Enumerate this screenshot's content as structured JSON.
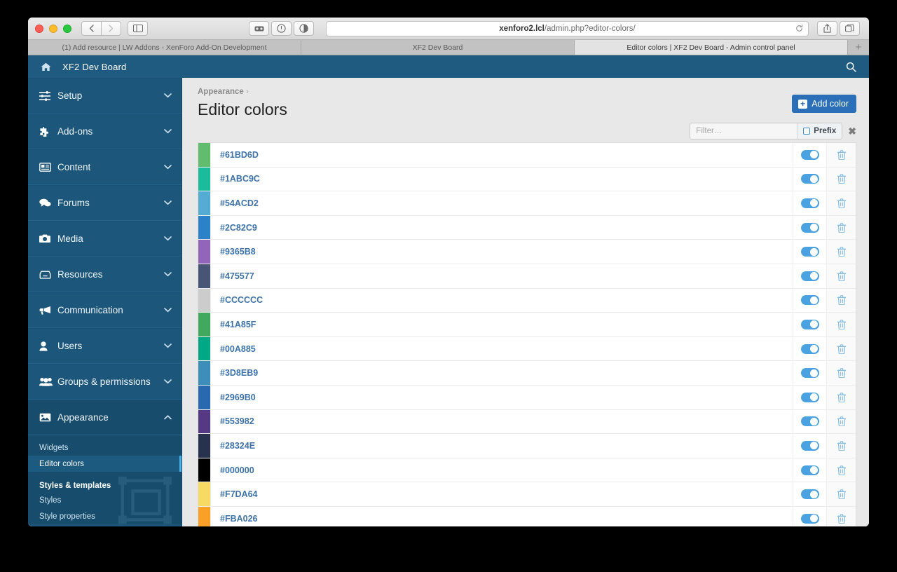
{
  "browser": {
    "url_host": "xenforo2.lcl",
    "url_path": "/admin.php?editor-colors/",
    "reload_icon": "reload-icon",
    "back_icon": "back-icon",
    "forward_icon": "forward-icon",
    "sidebar_icon": "sidebar-toggle-icon",
    "share_icon": "share-icon",
    "tabs_icon": "show-tabs-icon",
    "new_tab_label": "+",
    "tabs": [
      {
        "label": "(1) Add resource | LW Addons - XenForo Add-On Development",
        "active": false
      },
      {
        "label": "XF2 Dev Board",
        "active": false
      },
      {
        "label": "Editor colors | XF2 Dev Board - Admin control panel",
        "active": true
      }
    ]
  },
  "admin_header": {
    "home_icon": "home-icon",
    "brand": "XF2 Dev Board",
    "search_icon": "search-icon"
  },
  "sidebar": {
    "items": [
      {
        "label": "Setup",
        "icon": "sliders-icon",
        "open": false
      },
      {
        "label": "Add-ons",
        "icon": "puzzle-piece-icon",
        "open": false
      },
      {
        "label": "Content",
        "icon": "newspaper-icon",
        "open": false
      },
      {
        "label": "Forums",
        "icon": "comments-icon",
        "open": false
      },
      {
        "label": "Media",
        "icon": "camera-icon",
        "open": false
      },
      {
        "label": "Resources",
        "icon": "archive-icon",
        "open": false
      },
      {
        "label": "Communication",
        "icon": "bullhorn-icon",
        "open": false
      },
      {
        "label": "Users",
        "icon": "user-icon",
        "open": false
      },
      {
        "label": "Groups & permissions",
        "icon": "users-icon",
        "open": false
      },
      {
        "label": "Appearance",
        "icon": "image-icon",
        "open": true
      }
    ],
    "sub_items": [
      {
        "label": "Widgets",
        "active": false,
        "heading": false
      },
      {
        "label": "Editor colors",
        "active": true,
        "heading": false
      },
      {
        "label": "Styles & templates",
        "active": false,
        "heading": true
      },
      {
        "label": "Styles",
        "active": false,
        "heading": false
      },
      {
        "label": "Style properties",
        "active": false,
        "heading": false
      }
    ],
    "watermark_icon": "object-transform-watermark-icon"
  },
  "main": {
    "breadcrumb_parent": "Appearance",
    "breadcrumb_separator": "›",
    "title": "Editor colors",
    "add_button": "Add color",
    "add_button_icon": "plus-square-icon",
    "add_button_color": "#2a6fb8",
    "filter_placeholder": "Filter…",
    "filter_value": "",
    "prefix_label": "Prefix",
    "prefix_checked": false,
    "clear_icon": "clear-x-icon",
    "toggle_icon": "toggle-on-icon",
    "delete_icon": "trash-icon",
    "rows": [
      {
        "name": "#61BD6D",
        "color": "#61BD6D",
        "enabled": true
      },
      {
        "name": "#1ABC9C",
        "color": "#1ABC9C",
        "enabled": true
      },
      {
        "name": "#54ACD2",
        "color": "#54ACD2",
        "enabled": true
      },
      {
        "name": "#2C82C9",
        "color": "#2C82C9",
        "enabled": true
      },
      {
        "name": "#9365B8",
        "color": "#9365B8",
        "enabled": true
      },
      {
        "name": "#475577",
        "color": "#475577",
        "enabled": true
      },
      {
        "name": "#CCCCCC",
        "color": "#CCCCCC",
        "enabled": true
      },
      {
        "name": "#41A85F",
        "color": "#41A85F",
        "enabled": true
      },
      {
        "name": "#00A885",
        "color": "#00A885",
        "enabled": true
      },
      {
        "name": "#3D8EB9",
        "color": "#3D8EB9",
        "enabled": true
      },
      {
        "name": "#2969B0",
        "color": "#2969B0",
        "enabled": true
      },
      {
        "name": "#553982",
        "color": "#553982",
        "enabled": true
      },
      {
        "name": "#28324E",
        "color": "#28324E",
        "enabled": true
      },
      {
        "name": "#000000",
        "color": "#000000",
        "enabled": true
      },
      {
        "name": "#F7DA64",
        "color": "#F7DA64",
        "enabled": true
      },
      {
        "name": "#FBA026",
        "color": "#FBA026",
        "enabled": true
      }
    ]
  }
}
